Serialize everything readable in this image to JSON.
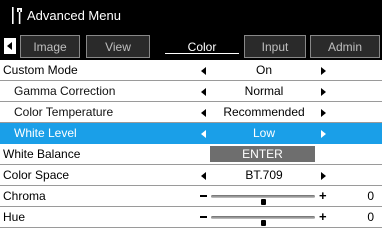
{
  "title": "Advanced Menu",
  "tabs": [
    {
      "label": "Image",
      "active": false
    },
    {
      "label": "View",
      "active": false
    },
    {
      "label": "Color",
      "active": true
    },
    {
      "label": "Input",
      "active": false
    },
    {
      "label": "Admin",
      "active": false
    }
  ],
  "rows": [
    {
      "label": "Custom Mode",
      "value": "On",
      "type": "select",
      "indent": false,
      "selected": false
    },
    {
      "label": "Gamma Correction",
      "value": "Normal",
      "type": "select",
      "indent": true,
      "selected": false
    },
    {
      "label": "Color Temperature",
      "value": "Recommended",
      "type": "select",
      "indent": true,
      "selected": false
    },
    {
      "label": "White Level",
      "value": "Low",
      "type": "select",
      "indent": true,
      "selected": true
    },
    {
      "label": "White Balance",
      "value": "ENTER",
      "type": "button",
      "indent": false,
      "selected": false
    },
    {
      "label": "Color Space",
      "value": "BT.709",
      "type": "select",
      "indent": false,
      "selected": false
    },
    {
      "label": "Chroma",
      "value": "0",
      "type": "slider",
      "level": 0.5,
      "indent": false,
      "selected": false
    },
    {
      "label": "Hue",
      "value": "0",
      "type": "slider",
      "level": 0.5,
      "indent": false,
      "selected": false
    }
  ],
  "slider_signs": {
    "minus": "−",
    "plus": "+"
  },
  "colors": {
    "selected_row": "#1a9fe8",
    "menu_background": "#000000",
    "enter_button": "#6e6e6e"
  },
  "icons": {
    "title": "tools-icon",
    "tab_scroll": "arrow-left-icon",
    "value_prev": "arrow-left-icon",
    "value_next": "arrow-right-icon"
  }
}
